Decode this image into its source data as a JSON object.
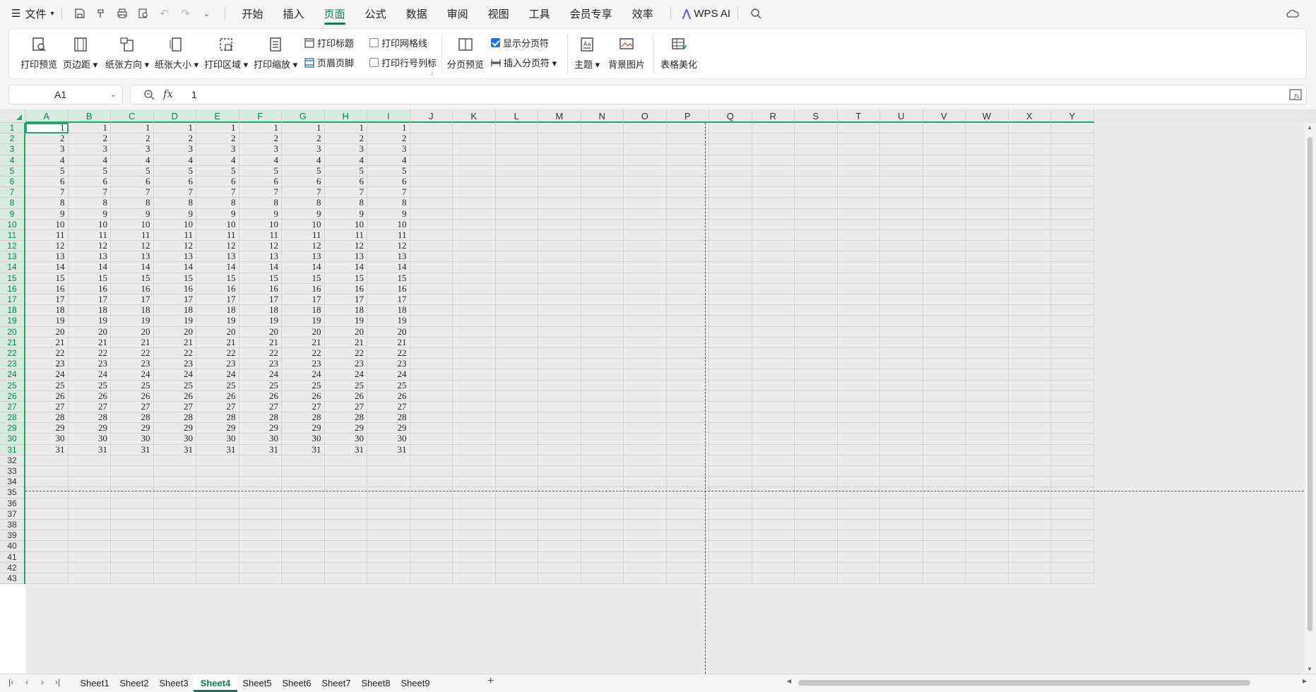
{
  "menubar": {
    "file_label": "文件",
    "tabs": [
      "开始",
      "插入",
      "页面",
      "公式",
      "数据",
      "审阅",
      "视图",
      "工具",
      "会员专享",
      "效率"
    ],
    "active_tab": "页面",
    "ai_label": "WPS AI"
  },
  "ribbon": {
    "print_preview": "打印预览",
    "margins": "页边距",
    "orientation": "纸张方向",
    "size": "纸张大小",
    "print_area": "打印区域",
    "print_scale": "打印缩放",
    "print_titles": "打印标题",
    "header_footer": "页眉页脚",
    "print_gridlines": "打印网格线",
    "print_row_col": "打印行号列标",
    "page_break_preview": "分页预览",
    "show_page_breaks": "显示分页符",
    "insert_page_break": "插入分页符",
    "theme": "主题",
    "background": "背景图片",
    "beautify": "表格美化"
  },
  "formula_bar": {
    "cell_ref": "A1",
    "value": "1"
  },
  "grid": {
    "columns": [
      "A",
      "B",
      "C",
      "D",
      "E",
      "F",
      "G",
      "H",
      "I",
      "J",
      "K",
      "L",
      "M",
      "N",
      "O",
      "P",
      "Q",
      "R",
      "S",
      "T",
      "U",
      "V",
      "W",
      "X",
      "Y"
    ],
    "rows": [
      "1",
      "2",
      "3",
      "4",
      "5",
      "6",
      "7",
      "8",
      "9",
      "10",
      "11",
      "12",
      "13",
      "14",
      "15",
      "16",
      "17",
      "18",
      "19",
      "20",
      "21",
      "22",
      "23",
      "24",
      "25",
      "26",
      "27",
      "28",
      "29",
      "30",
      "31",
      "32",
      "33",
      "34",
      "35",
      "36",
      "37",
      "38",
      "39",
      "40",
      "41",
      "42",
      "43"
    ],
    "filled_columns": 9,
    "filled_rows": 31
  },
  "sheets": {
    "tabs": [
      "Sheet1",
      "Sheet2",
      "Sheet3",
      "Sheet4",
      "Sheet5",
      "Sheet6",
      "Sheet7",
      "Sheet8",
      "Sheet9"
    ],
    "active": "Sheet4",
    "add_label": "+"
  },
  "colors": {
    "accent": "#0b7d5d",
    "selection": "#1aa86c"
  }
}
